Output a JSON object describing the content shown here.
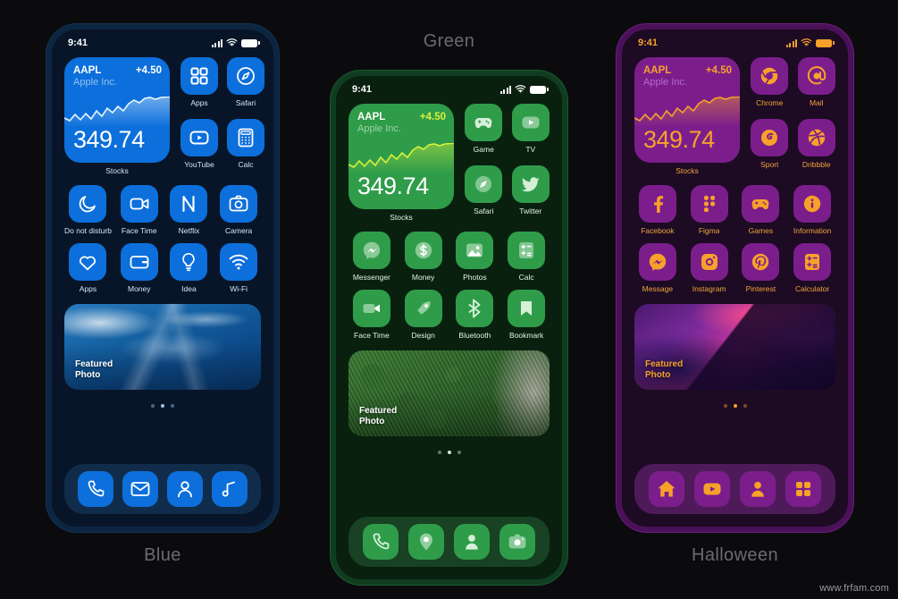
{
  "watermark": "www.frfam.com",
  "themes": [
    {
      "id": "blue",
      "caption": "Blue",
      "accent": "#0c6fdb",
      "status": {
        "time": "9:41"
      },
      "widget": {
        "ticker": "AAPL",
        "delta": "+4.50",
        "company": "Apple Inc.",
        "price": "349.74",
        "label": "Stocks"
      },
      "top_apps": [
        {
          "label": "Apps",
          "icon": "grid-apps-icon"
        },
        {
          "label": "Safari",
          "icon": "safari-compass-icon"
        },
        {
          "label": "YouTube",
          "icon": "youtube-play-icon"
        },
        {
          "label": "Calc",
          "icon": "calculator-icon"
        }
      ],
      "grid_apps": [
        {
          "label": "Do not disturb",
          "icon": "moon-icon"
        },
        {
          "label": "Face Time",
          "icon": "video-camera-icon"
        },
        {
          "label": "Netflix",
          "icon": "netflix-n-icon"
        },
        {
          "label": "Camera",
          "icon": "camera-icon"
        },
        {
          "label": "Apps",
          "icon": "heart-icon"
        },
        {
          "label": "Money",
          "icon": "wallet-icon"
        },
        {
          "label": "Idea",
          "icon": "lightbulb-icon"
        },
        {
          "label": "Wi-Fi",
          "icon": "wifi-icon"
        }
      ],
      "photo_widget": {
        "caption_line1": "Featured",
        "caption_line2": "Photo",
        "art": "blue-mountains"
      },
      "page_dots": {
        "count": 3,
        "active": 1
      },
      "dock": [
        {
          "label": "Phone",
          "icon": "phone-icon"
        },
        {
          "label": "Mail",
          "icon": "envelope-icon"
        },
        {
          "label": "Contacts",
          "icon": "person-icon"
        },
        {
          "label": "Music",
          "icon": "music-note-icon"
        }
      ]
    },
    {
      "id": "green",
      "caption": "Green",
      "accent": "#2f9c4a",
      "status": {
        "time": "9:41"
      },
      "widget": {
        "ticker": "AAPL",
        "delta": "+4.50",
        "company": "Apple Inc.",
        "price": "349.74",
        "label": "Stocks"
      },
      "top_apps": [
        {
          "label": "Game",
          "icon": "gamepad-icon"
        },
        {
          "label": "TV",
          "icon": "tv-play-icon"
        },
        {
          "label": "Safari",
          "icon": "safari-compass-icon"
        },
        {
          "label": "Twitter",
          "icon": "twitter-bird-icon"
        }
      ],
      "grid_apps": [
        {
          "label": "Messenger",
          "icon": "messenger-icon"
        },
        {
          "label": "Money",
          "icon": "dollar-coin-icon"
        },
        {
          "label": "Photos",
          "icon": "photos-icon"
        },
        {
          "label": "Calc",
          "icon": "calculator-icon"
        },
        {
          "label": "Face Time",
          "icon": "video-camera-icon"
        },
        {
          "label": "Design",
          "icon": "pen-nib-icon"
        },
        {
          "label": "Bluetooth",
          "icon": "bluetooth-icon"
        },
        {
          "label": "Bookmark",
          "icon": "bookmark-icon"
        }
      ],
      "photo_widget": {
        "caption_line1": "Featured",
        "caption_line2": "Photo",
        "art": "green-forest"
      },
      "page_dots": {
        "count": 3,
        "active": 1
      },
      "dock": [
        {
          "label": "Phone",
          "icon": "phone-icon"
        },
        {
          "label": "Maps",
          "icon": "map-pin-icon"
        },
        {
          "label": "Contacts",
          "icon": "person-icon"
        },
        {
          "label": "Camera",
          "icon": "camera-icon"
        }
      ]
    },
    {
      "id": "halloween",
      "caption": "Halloween",
      "accent": "#7b1e8c",
      "status": {
        "time": "9:41"
      },
      "widget": {
        "ticker": "AAPL",
        "delta": "+4.50",
        "company": "Apple Inc.",
        "price": "349.74",
        "label": "Stocks"
      },
      "top_apps": [
        {
          "label": "Chrome",
          "icon": "chrome-icon"
        },
        {
          "label": "Mail",
          "icon": "mail-at-icon"
        },
        {
          "label": "Sport",
          "icon": "sport-swirl-icon"
        },
        {
          "label": "Dribbble",
          "icon": "dribbble-icon"
        }
      ],
      "grid_apps": [
        {
          "label": "Facebook",
          "icon": "facebook-icon"
        },
        {
          "label": "Figma",
          "icon": "figma-icon"
        },
        {
          "label": "Games",
          "icon": "gamepad-icon"
        },
        {
          "label": "Information",
          "icon": "info-icon"
        },
        {
          "label": "Message",
          "icon": "messenger-icon"
        },
        {
          "label": "Instagram",
          "icon": "instagram-icon"
        },
        {
          "label": "Pinterest",
          "icon": "pinterest-icon"
        },
        {
          "label": "Calculator",
          "icon": "calculator-icon"
        }
      ],
      "photo_widget": {
        "caption_line1": "Featured",
        "caption_line2": "Photo",
        "art": "halloween-neon"
      },
      "page_dots": {
        "count": 3,
        "active": 1
      },
      "dock": [
        {
          "label": "Home",
          "icon": "home-icon"
        },
        {
          "label": "YouTube",
          "icon": "youtube-play-icon"
        },
        {
          "label": "Profile",
          "icon": "person-icon"
        },
        {
          "label": "Apps",
          "icon": "grid-apps-icon"
        }
      ]
    }
  ],
  "chart_data": {
    "type": "line",
    "title": "AAPL",
    "subtitle": "Apple Inc.",
    "annotation": "+4.50",
    "last_value": 349.74,
    "series": [
      {
        "name": "AAPL price",
        "values": [
          30,
          24,
          36,
          26,
          38,
          28,
          42,
          33,
          48,
          40,
          52,
          45,
          58,
          66,
          60,
          72,
          78,
          74,
          86,
          95
        ]
      }
    ],
    "xlabel": "",
    "ylabel": "",
    "grid": false,
    "legend": false
  }
}
